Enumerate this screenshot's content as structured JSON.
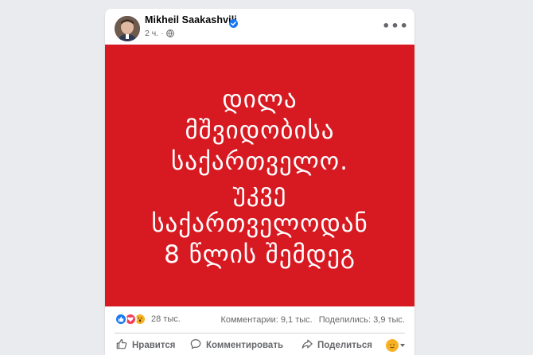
{
  "post": {
    "author": "Mikheil Saakashvili",
    "time": "2 ч.",
    "image_lines": [
      "დილა",
      "მშვიდობისა",
      "საქართველო.",
      "უკვე",
      "საქართველოდან",
      "8 წლის შემდეგ"
    ],
    "image_bg": "#d71921"
  },
  "stats": {
    "reactions_count": "28 тыс.",
    "comments": "Комментарии: 9,1 тыс.",
    "shares": "Поделились: 3,9 тыс."
  },
  "actions": {
    "like": "Нравится",
    "comment": "Комментировать",
    "share": "Поделиться"
  },
  "icons": {
    "verified": "verified-badge-icon",
    "privacy": "globe-icon",
    "more": "more-options-icon"
  },
  "colors": {
    "accent": "#1877f2",
    "muted": "#65676b"
  }
}
